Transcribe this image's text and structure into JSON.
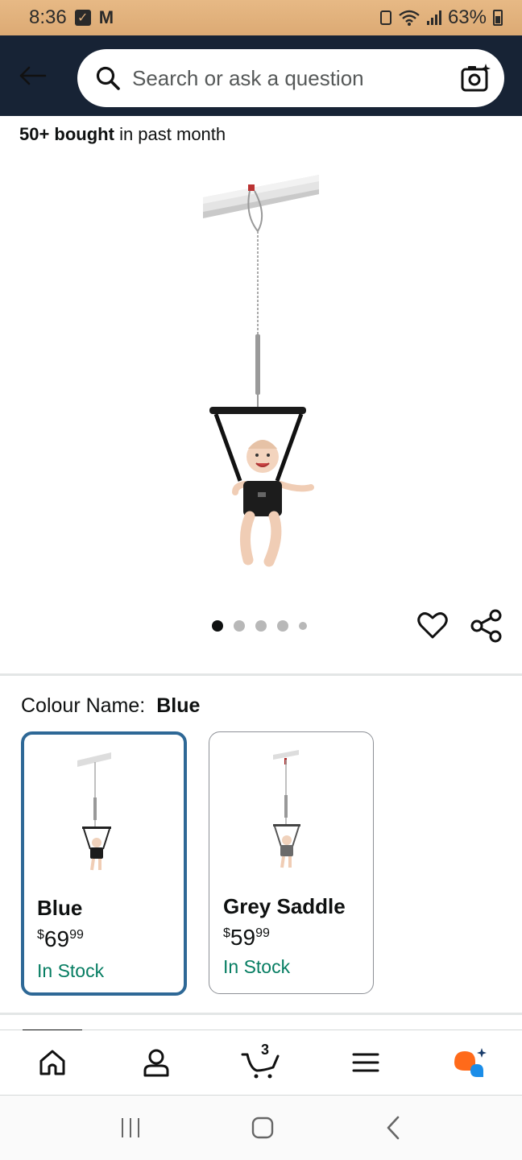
{
  "status_bar": {
    "time": "8:36",
    "battery": "63%"
  },
  "search": {
    "placeholder": "Search or ask a question"
  },
  "social_proof": {
    "bold": "50+ bought",
    "rest": " in past month"
  },
  "carousel": {
    "total_images": 5,
    "active_index": 0
  },
  "variation": {
    "label": "Colour Name:",
    "selected_value": "Blue",
    "options": [
      {
        "name": "Blue",
        "currency": "$",
        "price_whole": "69",
        "price_fraction": "99",
        "stock": "In Stock",
        "selected": true
      },
      {
        "name": "Grey Saddle",
        "currency": "$",
        "price_whole": "59",
        "price_fraction": "99",
        "stock": "In Stock",
        "selected": false
      }
    ]
  },
  "bottom_nav": {
    "items": [
      "home-icon",
      "account-icon",
      "cart-icon",
      "menu-icon",
      "rufus-icon"
    ],
    "cart_count": "3"
  },
  "colors": {
    "header_bg": "#172335",
    "selected_border": "#2e6896",
    "in_stock": "#067d62",
    "status_bar": "#dfae78"
  }
}
